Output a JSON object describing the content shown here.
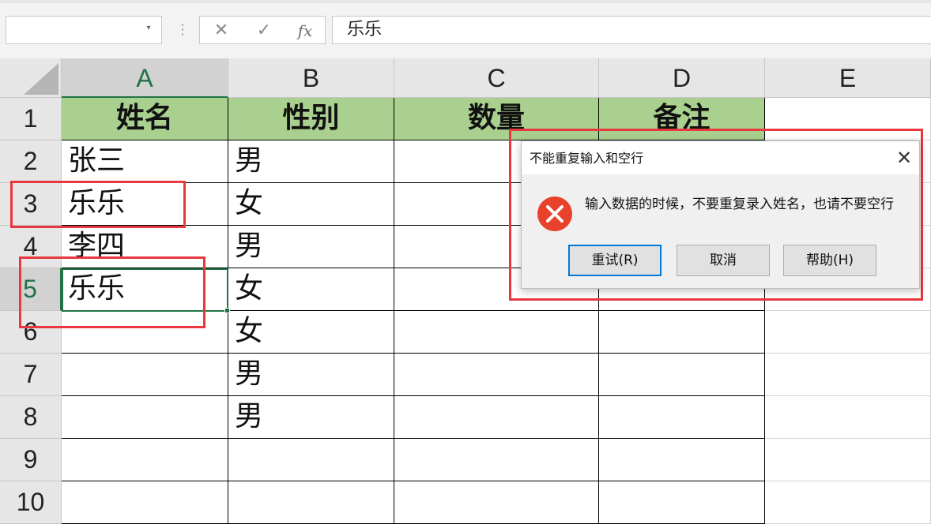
{
  "formula_bar": {
    "name_box_value": "",
    "cancel_icon": "cancel-x-icon",
    "enter_icon": "checkmark-icon",
    "fx_label": "fx",
    "formula_value": "乐乐"
  },
  "columns": [
    "A",
    "B",
    "C",
    "D",
    "E"
  ],
  "rows": [
    "1",
    "2",
    "3",
    "4",
    "5",
    "6",
    "7",
    "8",
    "9",
    "10"
  ],
  "table": {
    "headers": [
      "姓名",
      "性别",
      "数量",
      "备注"
    ],
    "rows": [
      [
        "张三",
        "男",
        "",
        ""
      ],
      [
        "乐乐",
        "女",
        "",
        ""
      ],
      [
        "李四",
        "男",
        "",
        ""
      ],
      [
        "乐乐",
        "女",
        "",
        ""
      ],
      [
        "",
        "女",
        "",
        ""
      ],
      [
        "",
        "男",
        "",
        ""
      ],
      [
        "",
        "男",
        "",
        ""
      ],
      [
        "",
        "",
        "",
        ""
      ],
      [
        "",
        "",
        "",
        ""
      ]
    ]
  },
  "active_cell": "A5",
  "colors": {
    "header_fill": "#a9d08e",
    "highlight_red": "#e8383d",
    "excel_green": "#217346",
    "error_red": "#e8412c",
    "focus_blue": "#0078d7"
  },
  "dialog": {
    "title": "不能重复输入和空行",
    "icon": "error-icon",
    "message": "输入数据的时候，不要重复录入姓名，也请不要空行",
    "buttons": {
      "retry": "重试(R)",
      "cancel": "取消",
      "help": "帮助(H)"
    },
    "close_glyph": "✕"
  }
}
